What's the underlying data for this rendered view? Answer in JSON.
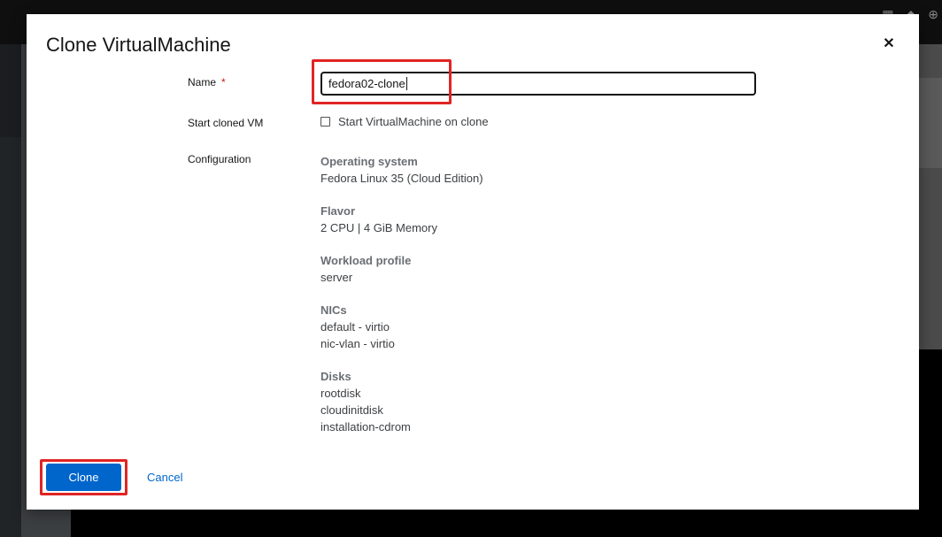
{
  "dialog": {
    "title": "Clone VirtualMachine",
    "close_icon": "close-icon"
  },
  "form": {
    "name_label": "Name",
    "name_required_mark": "*",
    "name_value": "fedora02-clone",
    "start_label": "Start cloned VM",
    "start_checkbox_label": "Start VirtualMachine on clone",
    "start_checked": false,
    "configuration_label": "Configuration"
  },
  "configuration": [
    {
      "heading": "Operating system",
      "values": [
        "Fedora Linux 35 (Cloud Edition)"
      ]
    },
    {
      "heading": "Flavor",
      "values": [
        "2 CPU | 4 GiB Memory"
      ]
    },
    {
      "heading": "Workload profile",
      "values": [
        "server"
      ]
    },
    {
      "heading": "NICs",
      "values": [
        "default - virtio",
        "nic-vlan - virtio"
      ]
    },
    {
      "heading": "Disks",
      "values": [
        "rootdisk",
        "cloudinitdisk",
        "installation-cdrom"
      ]
    }
  ],
  "footer": {
    "clone_label": "Clone",
    "cancel_label": "Cancel"
  },
  "colors": {
    "primary": "#0066cc",
    "highlight": "#e02424",
    "required": "#c9190b"
  }
}
